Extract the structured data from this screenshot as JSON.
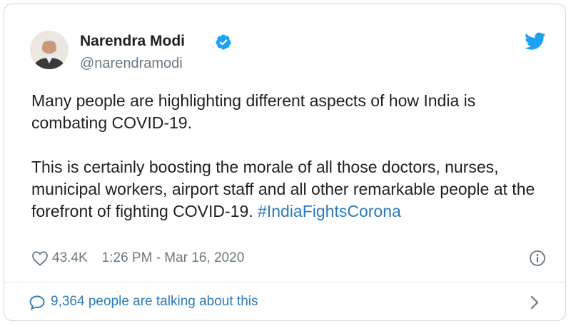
{
  "author": {
    "name": "Narendra Modi",
    "handle": "@narendramodi",
    "verified": true
  },
  "tweet": {
    "paragraph_1": "Many people are highlighting different aspects of how India is combating COVID-19.",
    "paragraph_2": "This is certainly boosting the morale of all those doctors, nurses, municipal workers, airport staff and all other remarkable people at the forefront of fighting COVID-19.",
    "hashtag": "#IndiaFightsCorona"
  },
  "meta": {
    "likes": "43.4K",
    "timestamp": "1:26 PM - Mar 16, 2020"
  },
  "footer": {
    "talking_text": "9,364 people are talking about this"
  },
  "colors": {
    "link_blue": "#2b7bb9",
    "twitter_blue": "#1da1f2",
    "secondary_gray": "#697882",
    "text_dark": "#1c2022",
    "border": "#cfd9de"
  },
  "icons": [
    "avatar",
    "verified-icon",
    "twitter-icon",
    "heart-icon",
    "info-icon",
    "comment-icon",
    "chevron-right-icon"
  ]
}
